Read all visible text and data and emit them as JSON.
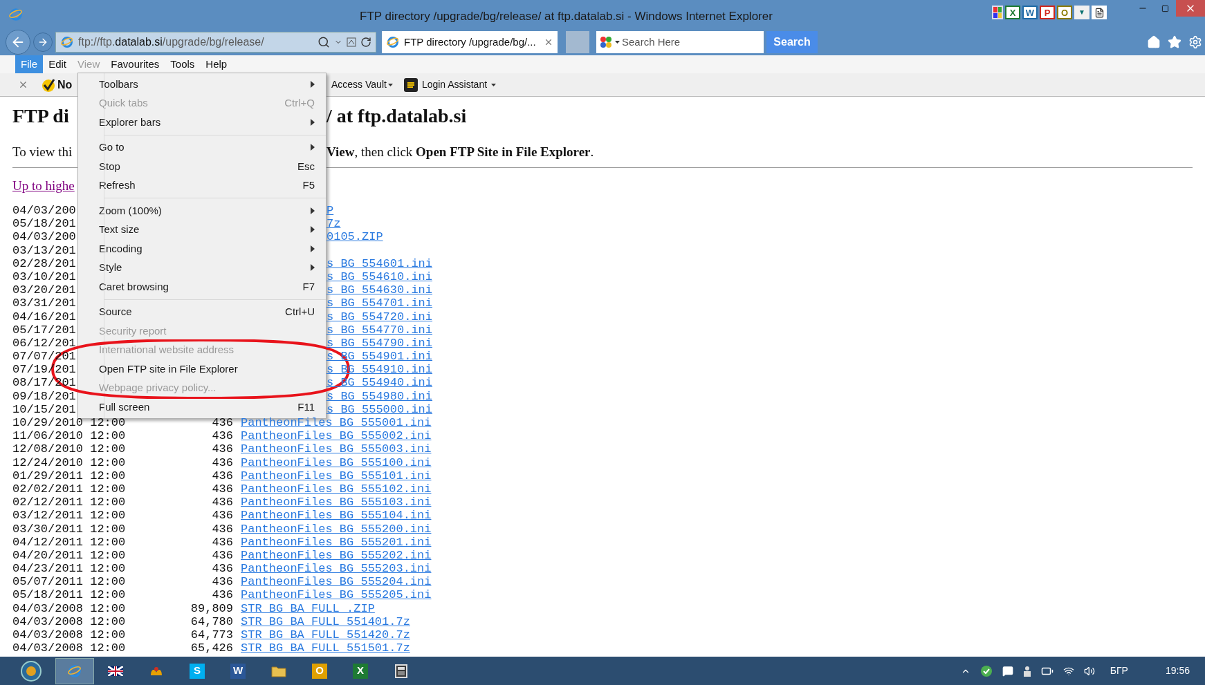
{
  "window": {
    "title": "FTP directory /upgrade/bg/release/ at ftp.datalab.si - Windows Internet Explorer"
  },
  "title_tools": [
    {
      "kind": "grid"
    },
    {
      "kind": "letter",
      "glyph": "X",
      "color": "#1e7b34"
    },
    {
      "kind": "letter",
      "glyph": "W",
      "color": "#1f6aa6"
    },
    {
      "kind": "letter",
      "glyph": "P",
      "color": "#d0271d"
    },
    {
      "kind": "letter",
      "glyph": "O",
      "color": "#8a7a00"
    },
    {
      "kind": "menu",
      "glyph": "▼"
    },
    {
      "kind": "document"
    }
  ],
  "address_bar": {
    "prefix": "ftp://ftp.",
    "domain": "datalab.si",
    "suffix": "/upgrade/bg/release/"
  },
  "tabs": [
    {
      "label": "FTP directory /upgrade/bg/...",
      "selected": true
    }
  ],
  "search": {
    "placeholder": "Search Here",
    "button": "Search"
  },
  "menu_bar": [
    {
      "label": "File",
      "highlighted": true,
      "open": false
    },
    {
      "label": "Edit",
      "highlighted": false,
      "open": false
    },
    {
      "label": "View",
      "highlighted": false,
      "open": true
    },
    {
      "label": "Favourites",
      "highlighted": false,
      "open": false
    },
    {
      "label": "Tools",
      "highlighted": false,
      "open": false
    },
    {
      "label": "Help",
      "highlighted": false,
      "open": false
    }
  ],
  "command_bar": [
    {
      "kind": "logo",
      "label": "No"
    },
    {
      "kind": "dropdown",
      "label": "Access Vault"
    },
    {
      "kind": "icon-dropdown",
      "label": "Login Assistant"
    }
  ],
  "dropdown_menu": [
    {
      "kind": "item",
      "label": "Toolbars",
      "submenu": true,
      "disabled": false
    },
    {
      "kind": "item",
      "label": "Quick tabs",
      "shortcut": "Ctrl+Q",
      "submenu": false,
      "disabled": true
    },
    {
      "kind": "item",
      "label": "Explorer bars",
      "submenu": true,
      "disabled": false
    },
    {
      "kind": "separator"
    },
    {
      "kind": "item",
      "label": "Go to",
      "submenu": true,
      "disabled": false
    },
    {
      "kind": "item",
      "label": "Stop",
      "shortcut": "Esc",
      "submenu": false,
      "disabled": false
    },
    {
      "kind": "item",
      "label": "Refresh",
      "shortcut": "F5",
      "submenu": false,
      "disabled": false
    },
    {
      "kind": "separator"
    },
    {
      "kind": "item",
      "label": "Zoom (100%)",
      "submenu": true,
      "disabled": false
    },
    {
      "kind": "item",
      "label": "Text size",
      "submenu": true,
      "disabled": false
    },
    {
      "kind": "item",
      "label": "Encoding",
      "submenu": true,
      "disabled": false
    },
    {
      "kind": "item",
      "label": "Style",
      "submenu": true,
      "disabled": false
    },
    {
      "kind": "item",
      "label": "Caret browsing",
      "shortcut": "F7",
      "submenu": false,
      "disabled": false
    },
    {
      "kind": "separator"
    },
    {
      "kind": "item",
      "label": "Source",
      "shortcut": "Ctrl+U",
      "submenu": false,
      "disabled": false
    },
    {
      "kind": "item",
      "label": "Security report",
      "submenu": false,
      "disabled": true
    },
    {
      "kind": "item",
      "label": "International website address",
      "submenu": false,
      "disabled": true
    },
    {
      "kind": "item",
      "label": "Open FTP site in File Explorer",
      "submenu": false,
      "disabled": false
    },
    {
      "kind": "item",
      "label": "Webpage privacy policy...",
      "submenu": false,
      "disabled": true
    },
    {
      "kind": "item",
      "label": "Full screen",
      "shortcut": "F11",
      "submenu": false,
      "disabled": false
    }
  ],
  "page": {
    "heading_left": "FTP di",
    "heading_right": "/ at ftp.datalab.si",
    "intro_left": "To view thi",
    "intro_right": "**View**, then click **Open FTP Site in File Explorer**.",
    "parent_link": "Up to highe",
    "rows": [
      {
        "kind": "covered",
        "date": "04/03/200",
        "name": "P"
      },
      {
        "kind": "covered",
        "date": "05/18/201",
        "name": "7z"
      },
      {
        "kind": "covered",
        "date": "04/03/200",
        "name": "0105.ZIP"
      },
      {
        "kind": "covered",
        "date": "03/13/201"
      },
      {
        "kind": "covered",
        "date": "02/28/201",
        "name": "s BG 554601.ini"
      },
      {
        "kind": "covered",
        "date": "03/10/201",
        "name": "s BG 554610.ini"
      },
      {
        "kind": "covered",
        "date": "03/20/201",
        "name": "s BG 554630.ini"
      },
      {
        "kind": "covered",
        "date": "03/31/201",
        "name": "s BG 554701.ini"
      },
      {
        "kind": "covered",
        "date": "04/16/201",
        "name": "s BG 554720.ini"
      },
      {
        "kind": "covered",
        "date": "05/17/201",
        "name": "s BG 554770.ini"
      },
      {
        "kind": "covered",
        "date": "06/12/201",
        "name": "s BG 554790.ini"
      },
      {
        "kind": "covered",
        "date": "07/07/201",
        "name": "s BG 554901.ini"
      },
      {
        "kind": "covered",
        "date": "07/19/201",
        "name": "s BG 554910.ini"
      },
      {
        "kind": "covered",
        "date": "08/17/201",
        "name": "s BG 554940.ini"
      },
      {
        "kind": "covered",
        "date": "09/18/201",
        "name": "s BG 554980.ini"
      },
      {
        "kind": "covered",
        "date": "10/15/201",
        "name": "s BG 555000.ini"
      },
      {
        "kind": "full",
        "date": "10/29/2010 12:00",
        "size": "436",
        "name": "PantheonFiles BG 555001.ini"
      },
      {
        "kind": "full",
        "date": "11/06/2010 12:00",
        "size": "436",
        "name": "PantheonFiles BG 555002.ini"
      },
      {
        "kind": "full",
        "date": "12/08/2010 12:00",
        "size": "436",
        "name": "PantheonFiles BG 555003.ini"
      },
      {
        "kind": "full",
        "date": "12/24/2010 12:00",
        "size": "436",
        "name": "PantheonFiles BG 555100.ini"
      },
      {
        "kind": "full",
        "date": "01/29/2011 12:00",
        "size": "436",
        "name": "PantheonFiles BG 555101.ini"
      },
      {
        "kind": "full",
        "date": "02/02/2011 12:00",
        "size": "436",
        "name": "PantheonFiles BG 555102.ini"
      },
      {
        "kind": "full",
        "date": "02/12/2011 12:00",
        "size": "436",
        "name": "PantheonFiles BG 555103.ini"
      },
      {
        "kind": "full",
        "date": "03/12/2011 12:00",
        "size": "436",
        "name": "PantheonFiles BG 555104.ini"
      },
      {
        "kind": "full",
        "date": "03/30/2011 12:00",
        "size": "436",
        "name": "PantheonFiles BG 555200.ini"
      },
      {
        "kind": "full",
        "date": "04/12/2011 12:00",
        "size": "436",
        "name": "PantheonFiles BG 555201.ini"
      },
      {
        "kind": "full",
        "date": "04/20/2011 12:00",
        "size": "436",
        "name": "PantheonFiles BG 555202.ini"
      },
      {
        "kind": "full",
        "date": "04/23/2011 12:00",
        "size": "436",
        "name": "PantheonFiles BG 555203.ini"
      },
      {
        "kind": "full",
        "date": "05/07/2011 12:00",
        "size": "436",
        "name": "PantheonFiles BG 555204.ini"
      },
      {
        "kind": "full",
        "date": "05/18/2011 12:00",
        "size": "436",
        "name": "PantheonFiles BG 555205.ini"
      },
      {
        "kind": "full",
        "date": "04/03/2008 12:00",
        "size": "89,809",
        "name": "STR BG BA FULL .ZIP"
      },
      {
        "kind": "full",
        "date": "04/03/2008 12:00",
        "size": "64,780",
        "name": "STR BG BA FULL 551401.7z"
      },
      {
        "kind": "full",
        "date": "04/03/2008 12:00",
        "size": "64,773",
        "name": "STR BG BA FULL 551420.7z"
      },
      {
        "kind": "full",
        "date": "04/03/2008 12:00",
        "size": "65,426",
        "name": "STR BG BA FULL 551501.7z"
      }
    ]
  },
  "taskbar": {
    "apps": [
      {
        "kind": "round",
        "active": false
      },
      {
        "kind": "browser",
        "active": true
      },
      {
        "kind": "flag",
        "active": false
      },
      {
        "kind": "flower",
        "active": false
      },
      {
        "kind": "letter",
        "glyph": "S",
        "color": "#00aff0",
        "active": false
      },
      {
        "kind": "letter",
        "glyph": "W",
        "color": "#2b5797",
        "active": false
      },
      {
        "kind": "folder",
        "active": false
      },
      {
        "kind": "letter",
        "glyph": "O",
        "color": "#e0a000",
        "active": false
      },
      {
        "kind": "letter",
        "glyph": "X",
        "color": "#1e7b34",
        "active": false
      },
      {
        "kind": "calc",
        "active": false
      }
    ],
    "language": "БГР",
    "time": "19:56"
  }
}
